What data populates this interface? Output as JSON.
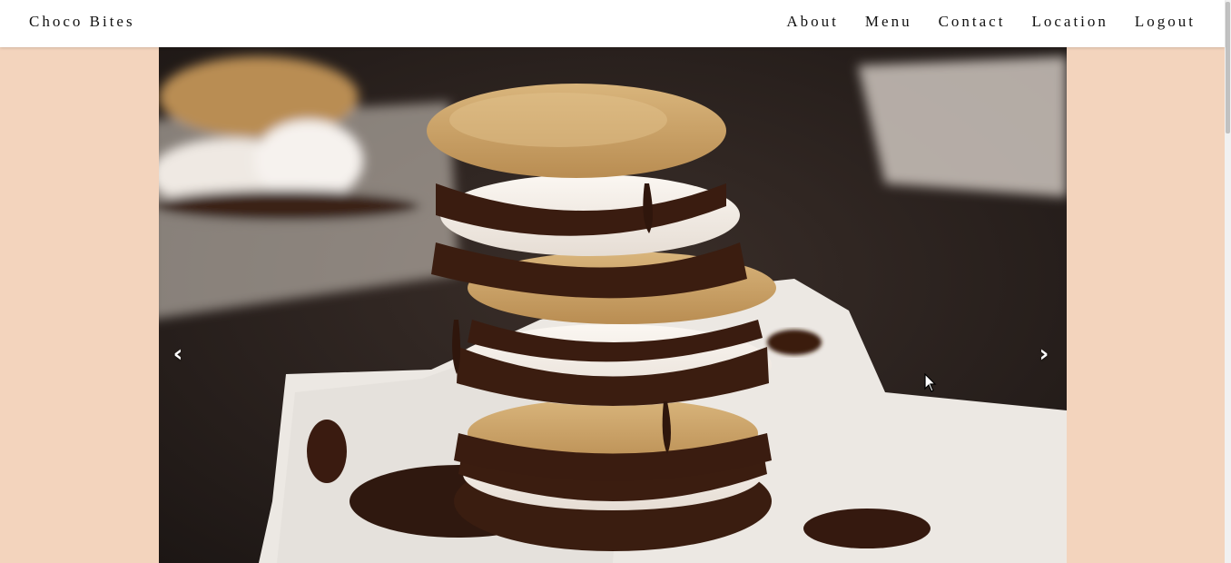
{
  "brand": {
    "name": "Choco Bites"
  },
  "nav": {
    "items": [
      {
        "label": "About"
      },
      {
        "label": "Menu"
      },
      {
        "label": "Contact"
      },
      {
        "label": "Location"
      },
      {
        "label": "Logout"
      }
    ]
  },
  "carousel": {
    "prev_label": "‹",
    "next_label": "›",
    "slide": {
      "icon": "smores-stack-photo"
    }
  },
  "colors": {
    "page_background": "#f3d4bd",
    "navbar_background": "#ffffff",
    "nav_text": "#111111"
  }
}
